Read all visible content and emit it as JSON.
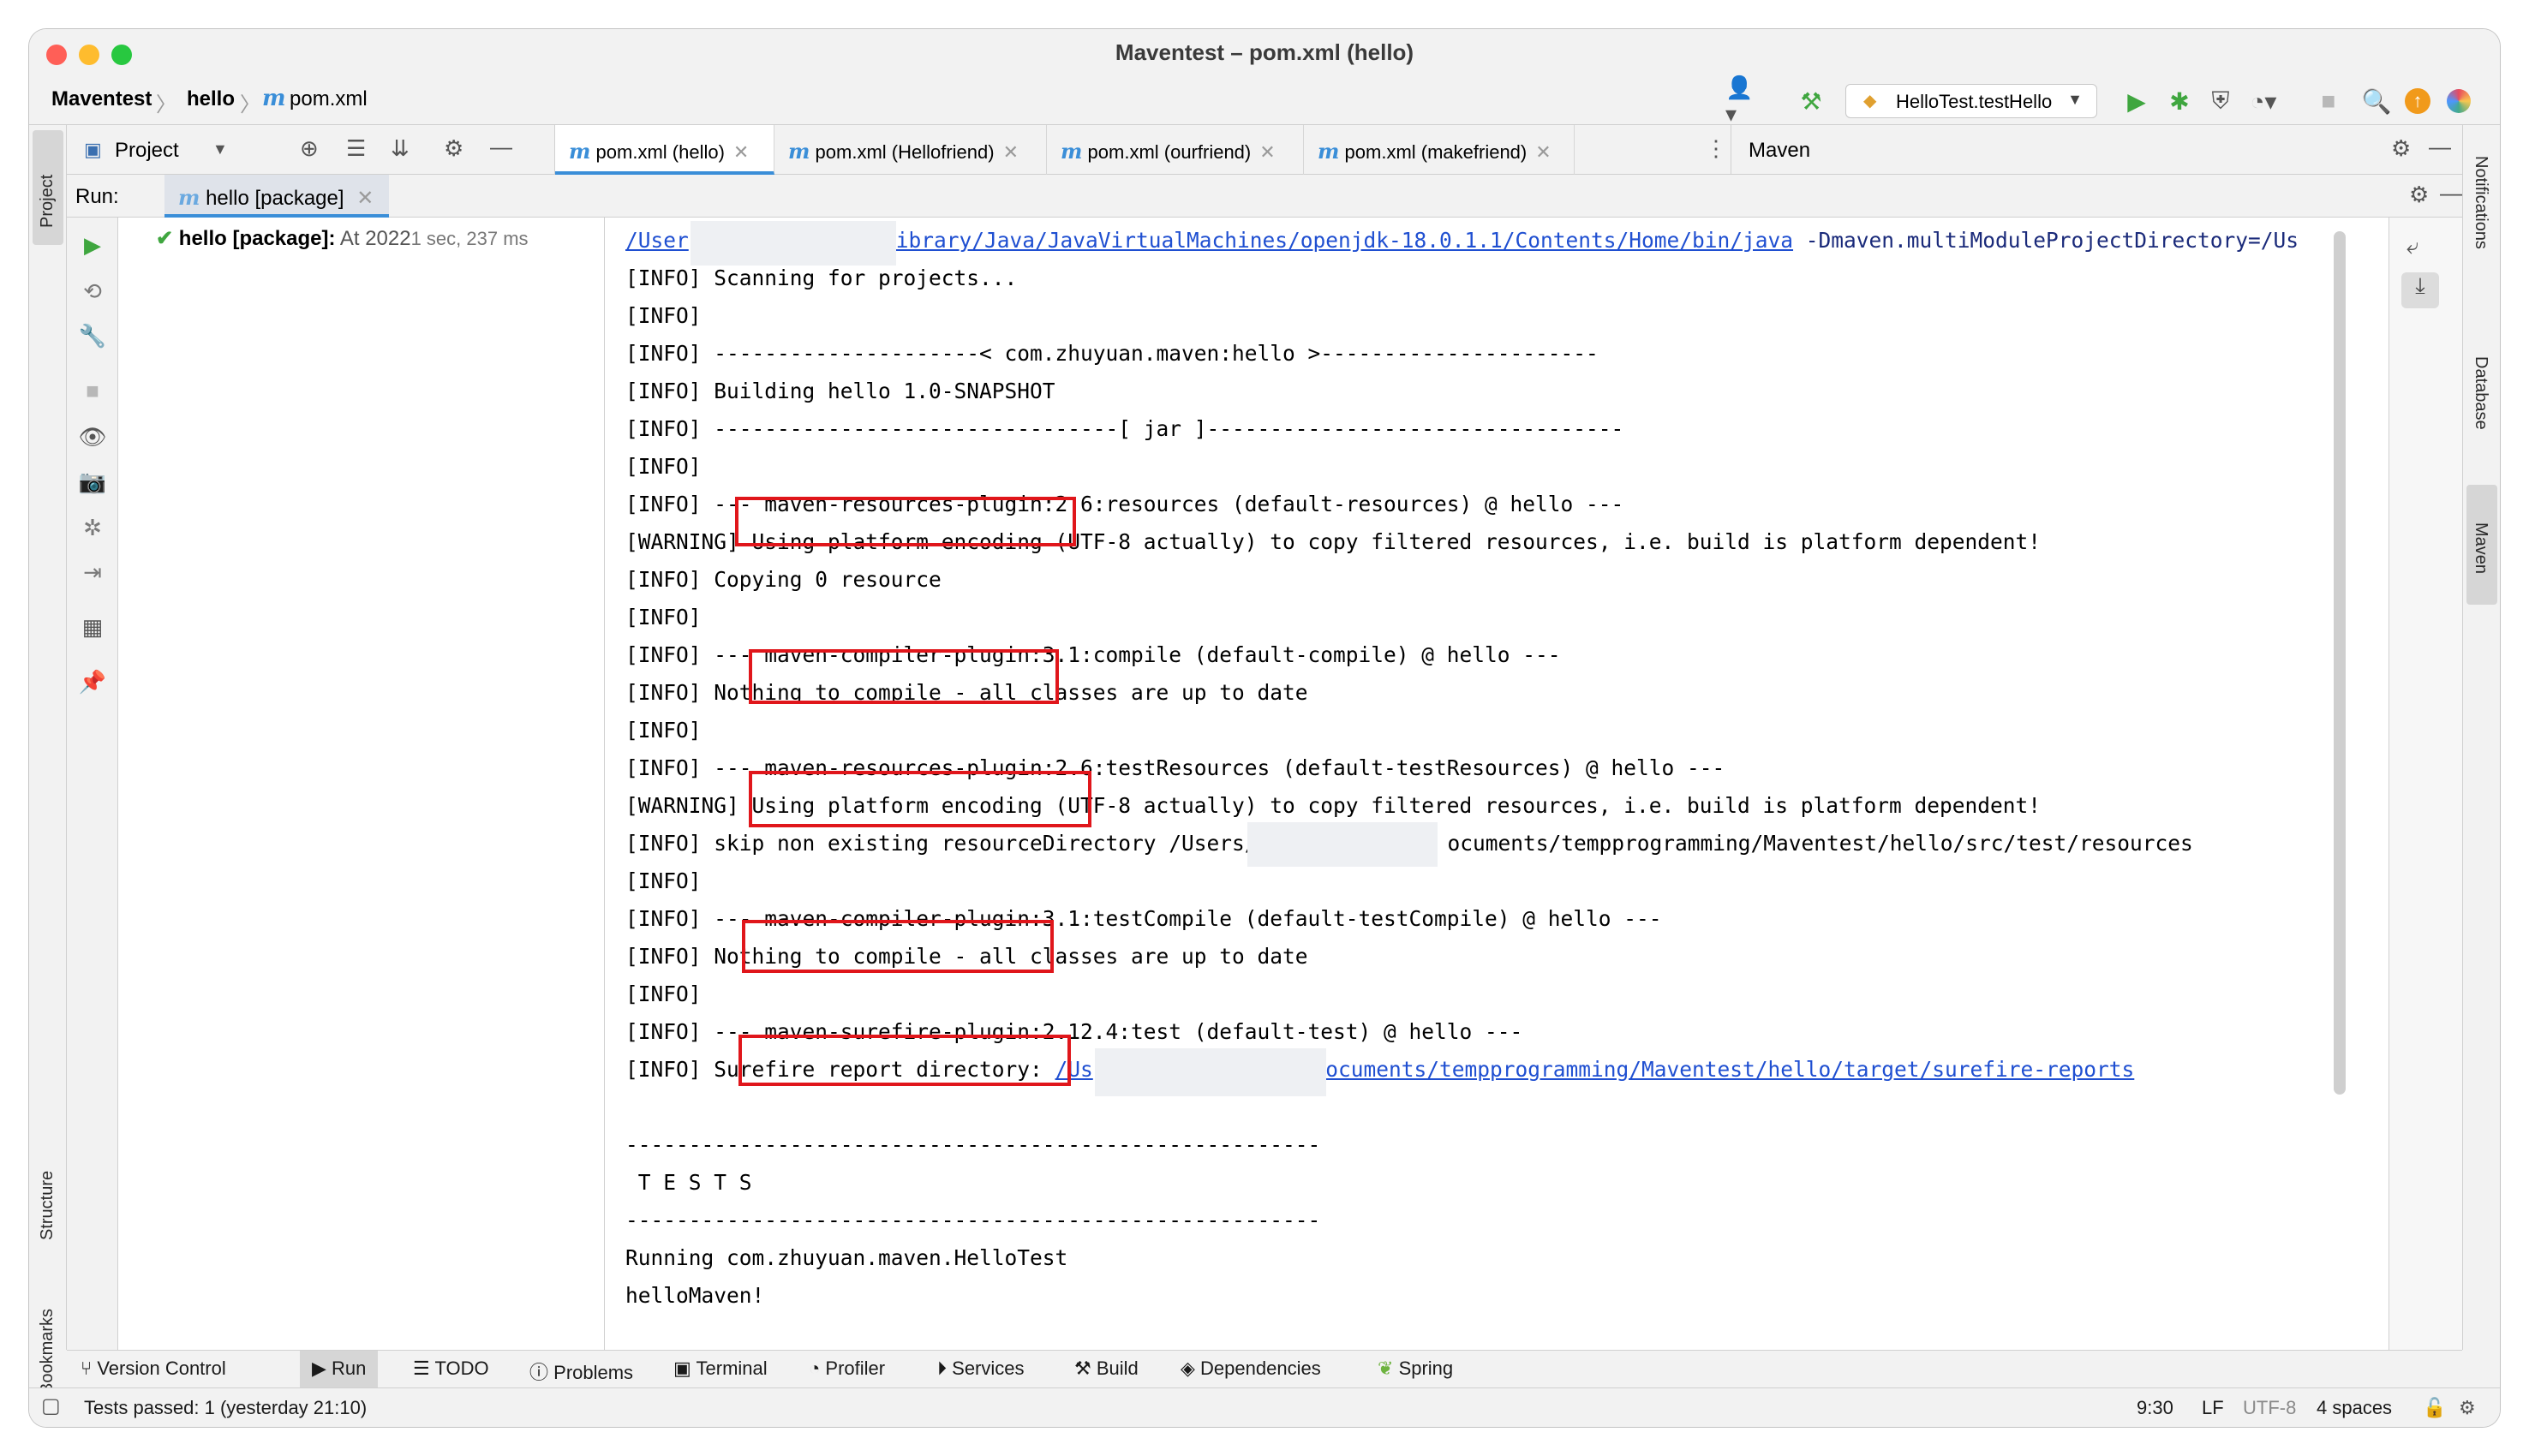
{
  "window": {
    "title": "Maventest – pom.xml (hello)"
  },
  "breadcrumb": {
    "project": "Maventest",
    "module": "hello",
    "file": "pom.xml"
  },
  "toolbar": {
    "run_config": "HelloTest.testHello"
  },
  "project_panel": {
    "label": "Project"
  },
  "editor_tabs": [
    {
      "label": "pom.xml (hello)",
      "active": true
    },
    {
      "label": "pom.xml (Hellofriend)"
    },
    {
      "label": "pom.xml (ourfriend)"
    },
    {
      "label": "pom.xml (makefriend)"
    }
  ],
  "maven_panel": {
    "label": "Maven"
  },
  "run": {
    "label": "Run:",
    "tab": "hello [package]",
    "tree_item_name": "hello [package]:",
    "tree_item_time": "At 2022",
    "tree_item_duration": "1 sec, 237 ms"
  },
  "console": {
    "lines": [
      "/User",
      "[INFO] Scanning for projects...",
      "[INFO]",
      "[INFO] ---------------------< com.zhuyuan.maven:hello >----------------------",
      "[INFO] Building hello 1.0-SNAPSHOT",
      "[INFO] --------------------------------[ jar ]---------------------------------",
      "[INFO]",
      "[INFO] --- maven-resources-plugin:2.6:resources (default-resources) @ hello ---",
      "[WARNING] Using platform encoding (UTF-8 actually) to copy filtered resources, i.e. build is platform dependent!",
      "[INFO] Copying 0 resource",
      "[INFO]",
      "[INFO] --- maven-compiler-plugin:3.1:compile (default-compile) @ hello ---",
      "[INFO] Nothing to compile - all classes are up to date",
      "[INFO]",
      "[INFO] --- maven-resources-plugin:2.6:testResources (default-testResources) @ hello ---",
      "[WARNING] Using platform encoding (UTF-8 actually) to copy filtered resources, i.e. build is platform dependent!",
      "[INFO] skip non existing resourceDirectory /Users/",
      "[INFO]",
      "[INFO] --- maven-compiler-plugin:3.1:testCompile (default-testCompile) @ hello ---",
      "[INFO] Nothing to compile - all classes are up to date",
      "[INFO]",
      "[INFO] --- maven-surefire-plugin:2.12.4:test (default-test) @ hello ---",
      "[INFO] Surefire report directory: ",
      "",
      "-------------------------------------------------------",
      " T E S T S",
      "-------------------------------------------------------",
      "Running com.zhuyuan.maven.HelloTest",
      "helloMaven!"
    ],
    "first_line_link": "ibrary/Java/JavaVirtualMachines/openjdk-18.0.1.1/Contents/Home/bin/java",
    "first_line_rest": " -Dmaven.multiModuleProjectDirectory=/Us",
    "resource_dir_tail": "ocuments/tempprogramming/Maventest/hello/src/test/resources",
    "surefire_link_head": "/Us",
    "surefire_link_tail": "/Documents/tempprogramming/Maventest/hello/target/surefire-reports"
  },
  "left_stripe": {
    "project": "Project",
    "structure": "Structure",
    "bookmarks": "Bookmarks"
  },
  "right_stripe": {
    "notifications": "Notifications",
    "database": "Database",
    "maven": "Maven"
  },
  "bottom_tabs": [
    "Version Control",
    "Run",
    "TODO",
    "Problems",
    "Terminal",
    "Profiler",
    "Services",
    "Build",
    "Dependencies",
    "Spring"
  ],
  "status": {
    "message": "Tests passed: 1 (yesterday 21:10)",
    "position": "9:30",
    "line_sep": "LF",
    "encoding": "UTF-8",
    "indent": "4 spaces"
  },
  "colors": {
    "accent": "#3a8ed8",
    "highlight_box": "#e0161b",
    "run_green": "#3fa63f"
  }
}
